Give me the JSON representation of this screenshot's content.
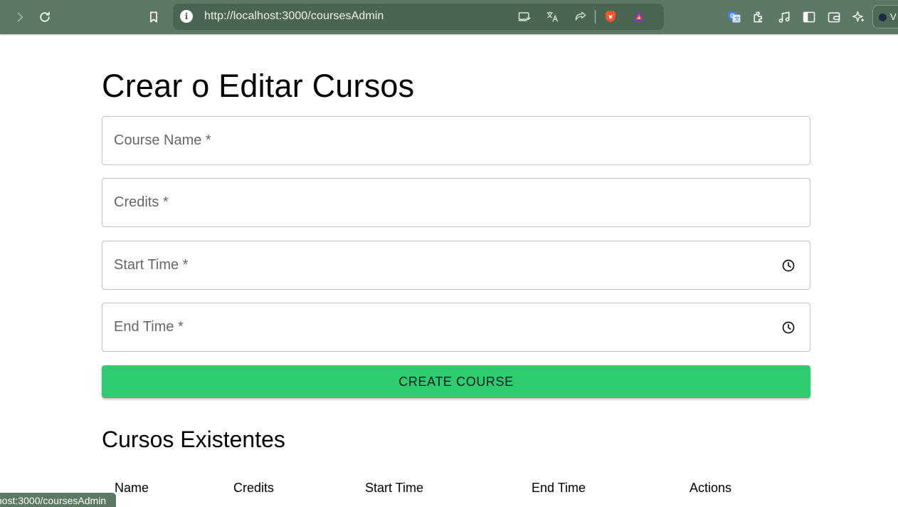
{
  "browser": {
    "url": "http://localhost:3000/coursesAdmin",
    "profile_initial": "V",
    "status_url": "host:3000/coursesAdmin",
    "icons": [
      "forward-icon",
      "reload-icon",
      "bookmark-icon",
      "site-info-icon",
      "install-app-icon",
      "translate-icon",
      "share-icon",
      "brave-shields-icon",
      "brave-rewards-icon",
      "google-translate-icon",
      "extensions-icon",
      "media-icon",
      "sidebar-icon",
      "wallet-icon",
      "leo-ai-icon"
    ],
    "colors": {
      "toolbar": "#5c7a63",
      "address_bar": "#4a6551"
    }
  },
  "form": {
    "title": "Crear o Editar Cursos",
    "fields": [
      {
        "label": "Course Name *",
        "value": ""
      },
      {
        "label": "Credits *",
        "value": ""
      },
      {
        "label": "Start Time *",
        "value": "",
        "icon": "clock-icon"
      },
      {
        "label": "End Time *",
        "value": "",
        "icon": "clock-icon"
      }
    ],
    "submit_label": "CREATE COURSE",
    "submit_color": "#2ecc71"
  },
  "courses": {
    "title": "Cursos Existentes",
    "columns": [
      "Name",
      "Credits",
      "Start Time",
      "End Time",
      "Actions"
    ]
  }
}
